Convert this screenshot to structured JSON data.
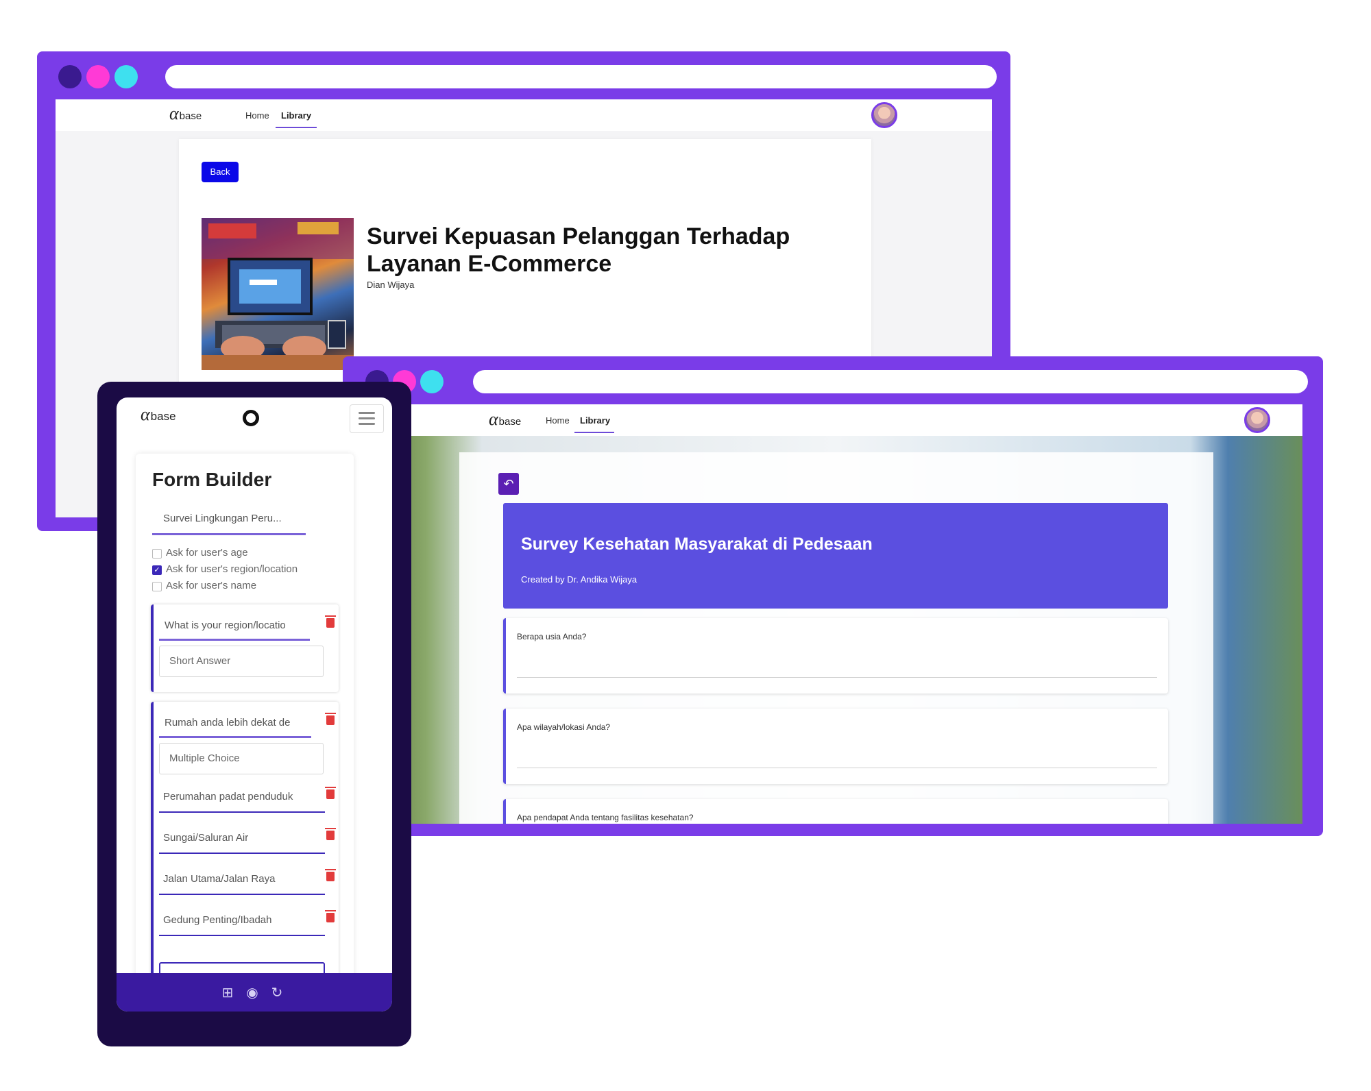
{
  "brand": {
    "logo_alpha": "α",
    "logo_text": "base"
  },
  "colors": {
    "frame": "#7a3ce8",
    "dot_1": "#3a1a8f",
    "dot_2": "#ff3ad6",
    "dot_3": "#3ee0ef",
    "primary_button": "#0b08e8",
    "survey_header": "#5b4fe0",
    "phone_footer": "#3a1aa0",
    "delete_icon": "#e23b3b"
  },
  "window_back": {
    "nav": {
      "home": "Home",
      "library": "Library"
    },
    "back_button": "Back",
    "survey_title": "Survei Kepuasan Pelanggan Terhadap Layanan E-Commerce",
    "author": "Dian Wijaya"
  },
  "window_front": {
    "nav": {
      "home": "Home",
      "library": "Library"
    },
    "back_icon": "undo-arrow-icon",
    "survey_title": "Survey Kesehatan Masyarakat di Pedesaan",
    "created_by": "Created by Dr. Andika Wijaya",
    "questions": [
      "Berapa usia Anda?",
      "Apa wilayah/lokasi Anda?",
      "Apa pendapat Anda tentang fasilitas kesehatan?"
    ]
  },
  "phone": {
    "title": "Form Builder",
    "form_name": "Survei Lingkungan Peru...",
    "options": [
      {
        "label": "Ask for user's age",
        "checked": false
      },
      {
        "label": "Ask for user's region/location",
        "checked": true
      },
      {
        "label": "Ask for user's name",
        "checked": false
      }
    ],
    "question_1": {
      "text": "What is your region/locatio",
      "type": "Short Answer"
    },
    "question_2": {
      "text": "Rumah anda lebih dekat de",
      "type": "Multiple Choice",
      "choices": [
        "Perumahan padat penduduk",
        "Sungai/Saluran Air",
        "Jalan Utama/Jalan Raya",
        "Gedung Penting/Ibadah"
      ]
    },
    "footer_icons": [
      "add-square-icon",
      "eye-icon",
      "refresh-icon"
    ]
  }
}
